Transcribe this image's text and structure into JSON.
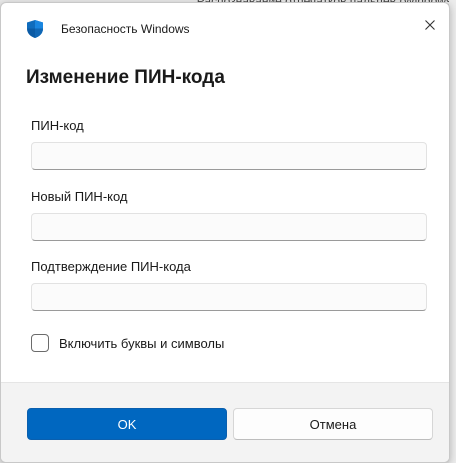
{
  "background": {
    "window_text": "Распознавание отпечатков пальцев (Windows"
  },
  "titlebar": {
    "app_name": "Безопасность Windows",
    "icon": "windows-security-shield-icon",
    "close_icon": "close-icon"
  },
  "dialog": {
    "title": "Изменение ПИН-кода",
    "fields": [
      {
        "label": "ПИН-код",
        "value": ""
      },
      {
        "label": "Новый ПИН-код",
        "value": ""
      },
      {
        "label": "Подтверждение ПИН-кода",
        "value": ""
      }
    ],
    "checkbox": {
      "label": "Включить буквы и символы",
      "checked": false
    }
  },
  "footer": {
    "ok_label": "OK",
    "cancel_label": "Отмена"
  },
  "colors": {
    "accent": "#0067c0",
    "shield": "#0f6cbd"
  }
}
